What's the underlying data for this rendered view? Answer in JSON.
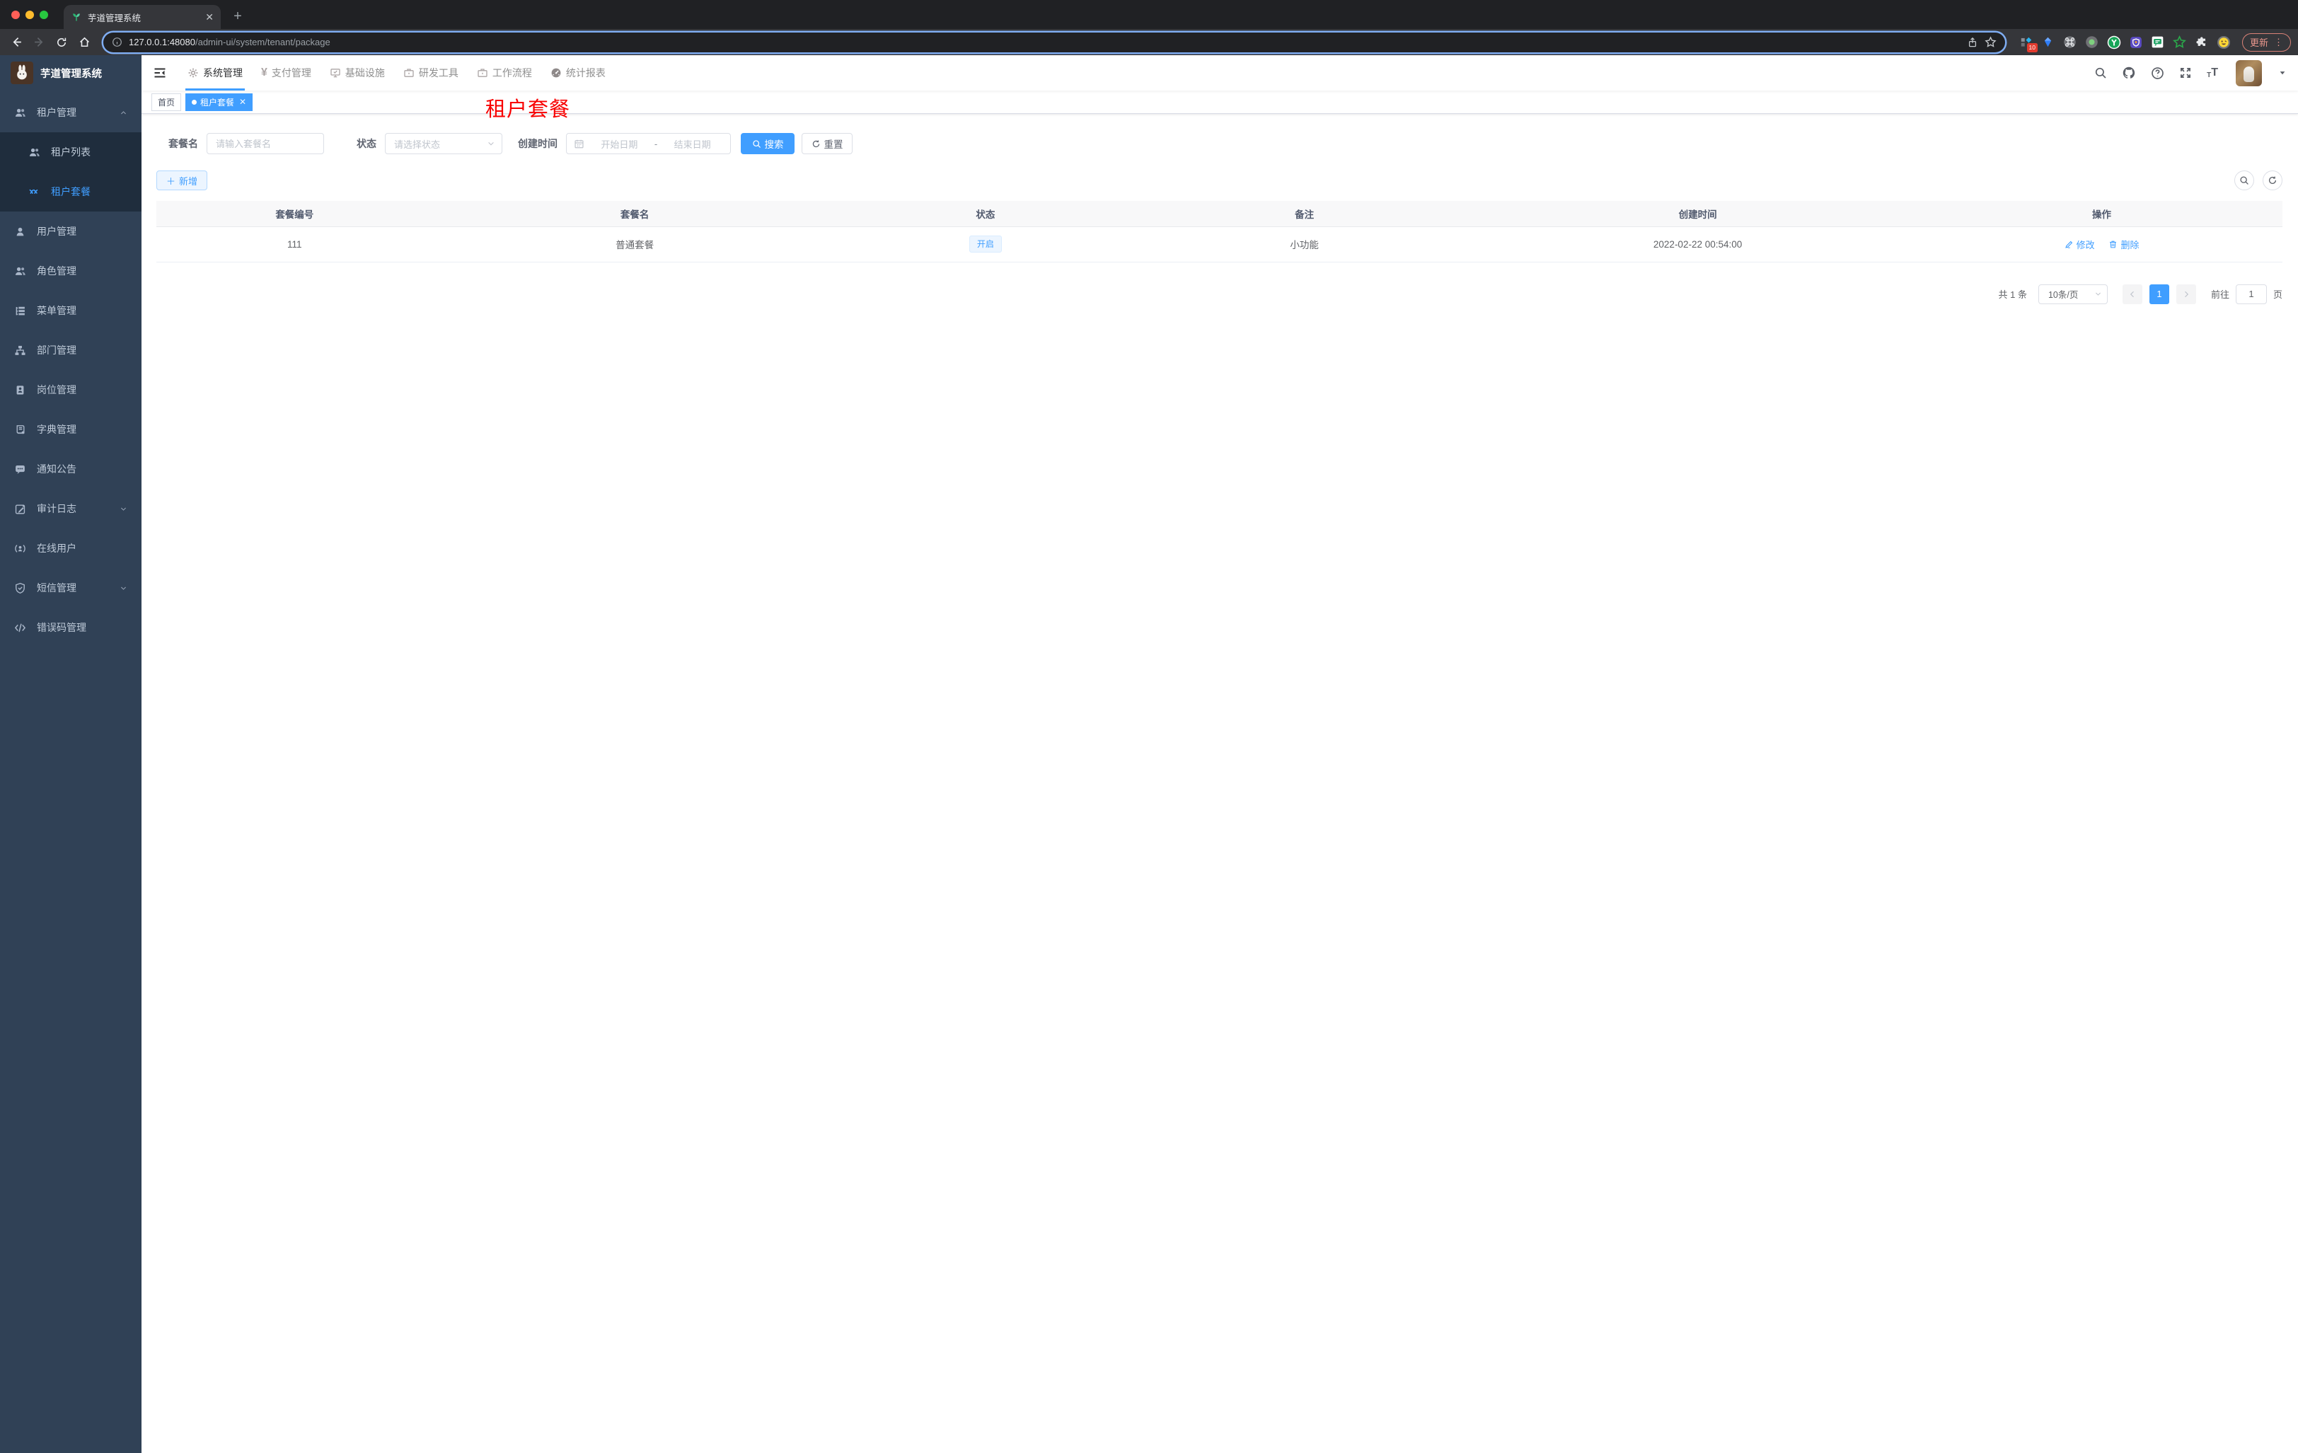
{
  "browser": {
    "tab_title": "芋道管理系统",
    "url_host": "127.0.0.1:48080",
    "url_path": "/admin-ui/system/tenant/package",
    "ext_badge": "10",
    "update_label": "更新"
  },
  "header": {
    "logo_title": "芋道管理系统",
    "yen": "¥",
    "nav": [
      {
        "label": "系统管理"
      },
      {
        "label": "支付管理"
      },
      {
        "label": "基础设施"
      },
      {
        "label": "研发工具"
      },
      {
        "label": "工作流程"
      },
      {
        "label": "统计报表"
      }
    ]
  },
  "sidebar": {
    "items": [
      {
        "label": "租户管理"
      },
      {
        "label": "租户列表"
      },
      {
        "label": "租户套餐"
      },
      {
        "label": "用户管理"
      },
      {
        "label": "角色管理"
      },
      {
        "label": "菜单管理"
      },
      {
        "label": "部门管理"
      },
      {
        "label": "岗位管理"
      },
      {
        "label": "字典管理"
      },
      {
        "label": "通知公告"
      },
      {
        "label": "审计日志"
      },
      {
        "label": "在线用户"
      },
      {
        "label": "短信管理"
      },
      {
        "label": "错误码管理"
      }
    ]
  },
  "tags": {
    "home": "首页",
    "active": "租户套餐"
  },
  "watermark": "租户套餐",
  "filters": {
    "name_label": "套餐名",
    "name_placeholder": "请输入套餐名",
    "status_label": "状态",
    "status_placeholder": "请选择状态",
    "date_label": "创建时间",
    "date_start": "开始日期",
    "date_sep": "-",
    "date_end": "结束日期",
    "search_label": "搜索",
    "reset_label": "重置"
  },
  "toolbar": {
    "add_label": "新增"
  },
  "table": {
    "columns": [
      "套餐编号",
      "套餐名",
      "状态",
      "备注",
      "创建时间",
      "操作"
    ],
    "row": {
      "id": "111",
      "name": "普通套餐",
      "status": "开启",
      "remark": "小功能",
      "created": "2022-02-22 00:54:00",
      "edit_label": "修改",
      "delete_label": "删除"
    }
  },
  "pagination": {
    "total": "共 1 条",
    "size": "10条/页",
    "page": "1",
    "goto": "前往",
    "goto_value": "1",
    "unit": "页"
  },
  "colors": {
    "primary": "#409eff",
    "sidebar_bg": "#304156",
    "submenu_bg": "#1f2d3d",
    "watermark_red": "#f80000",
    "tabstrip_bg": "#202124",
    "toolbar_bg": "#35363a"
  }
}
